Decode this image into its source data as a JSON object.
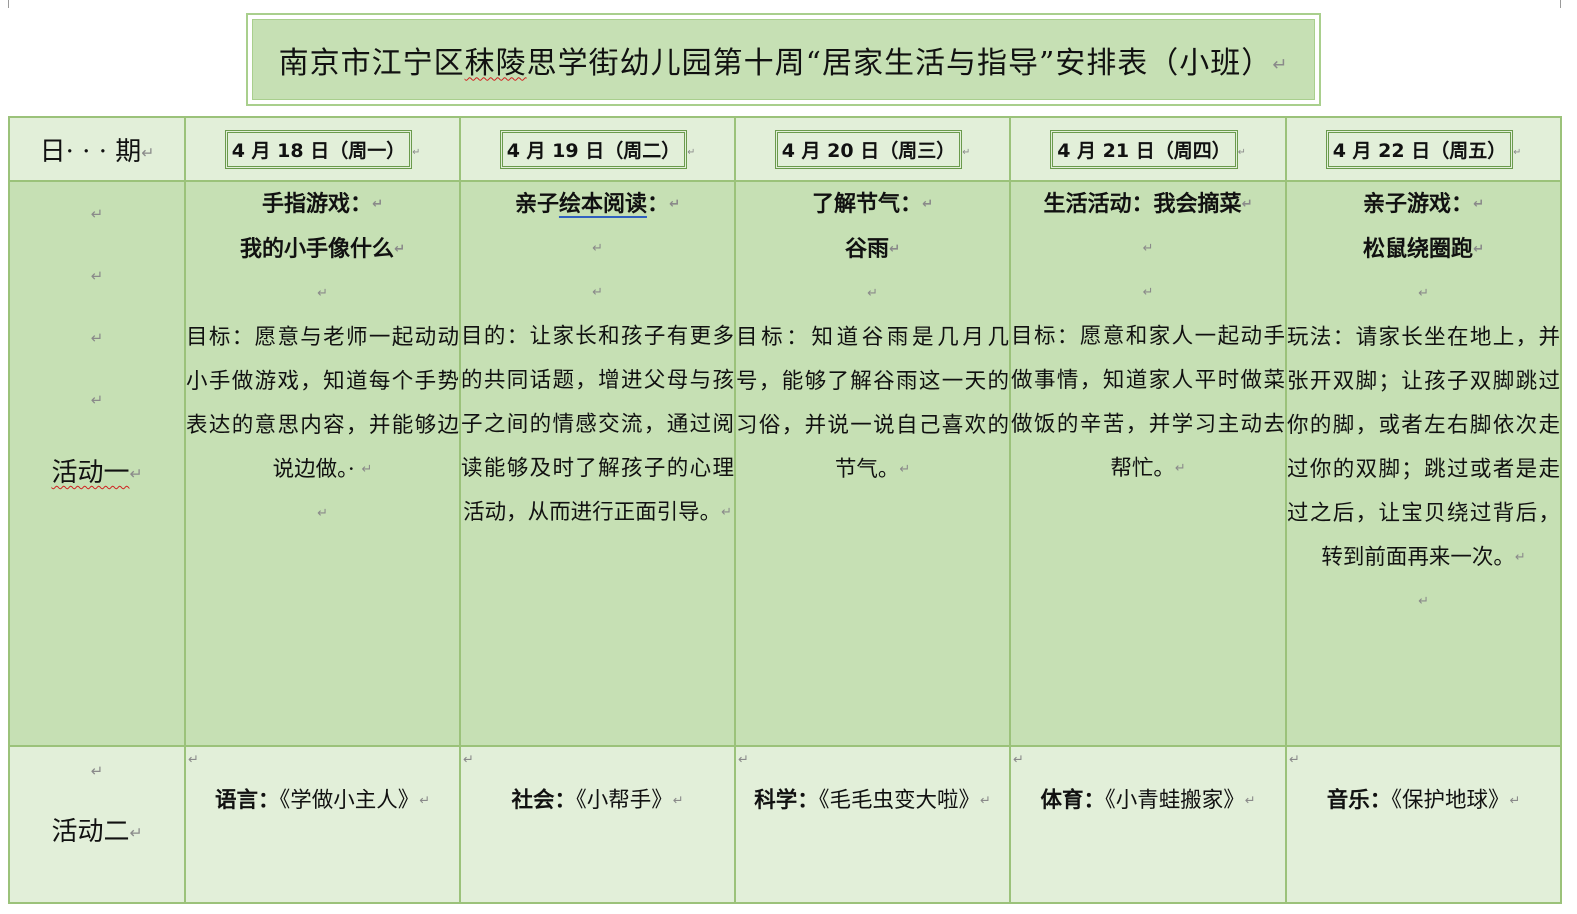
{
  "title": {
    "part1": "南京市江宁区",
    "part2": "秣陵",
    "part3": "思学街幼儿园第十周“居家生活与指导”安排表（小班）"
  },
  "header": {
    "date_label": "日· · · 期",
    "dates": [
      "4 月 18 日（周一）",
      "4 月 19 日（周二）",
      "4 月 20 日（周三）",
      "4 月 21 日（周四）",
      "4 月 22 日（周五）"
    ]
  },
  "activity_one": {
    "label": "活动一",
    "monday": {
      "head1": "手指游戏：",
      "head2": "我的小手像什么",
      "body": "目标：愿意与老师一起动动小手做游戏，知道每个手势表达的意思内容，并能够边说边做。· "
    },
    "tuesday": {
      "head1a": "亲子",
      "head1b": "绘本阅读",
      "head1c": "：",
      "body": "目的：让家长和孩子有更多的共同话题，增进父母与孩子之间的情感交流，通过阅读能够及时了解孩子的心理活动，从而进行正面引导。"
    },
    "wednesday": {
      "head1": "了解节气：",
      "head2": "谷雨",
      "body": "目标：知道谷雨是几月几号，能够了解谷雨这一天的习俗，并说一说自己喜欢的节气。"
    },
    "thursday": {
      "head1": "生活活动：我会摘菜",
      "body": "目标：愿意和家人一起动手做事情，知道家人平时做菜做饭的辛苦，并学习主动去帮忙。"
    },
    "friday": {
      "head1": "亲子游戏：",
      "head2": "松鼠绕圈跑",
      "body": "玩法：请家长坐在地上，并张开双脚；让孩子双脚跳过你的脚，或者左右脚依次走过你的双脚；跳过或者是走过之后，让宝贝绕过背后，转到前面再来一次。"
    }
  },
  "activity_two": {
    "label": "活动二",
    "items": [
      {
        "subject": "语言：",
        "title": "《学做小主人》"
      },
      {
        "subject": "社会：",
        "title": "《小帮手》"
      },
      {
        "subject": "科学：",
        "title": "《毛毛虫变大啦》"
      },
      {
        "subject": "体育：",
        "title": "《小青蛙搬家》"
      },
      {
        "subject": "音乐：",
        "title": "《保护地球》"
      }
    ]
  },
  "marks": {
    "return": "↵"
  },
  "colors": {
    "table_border": "#9bc27a",
    "row_dark": "#c6e0b4",
    "row_light": "#e2efd9"
  }
}
